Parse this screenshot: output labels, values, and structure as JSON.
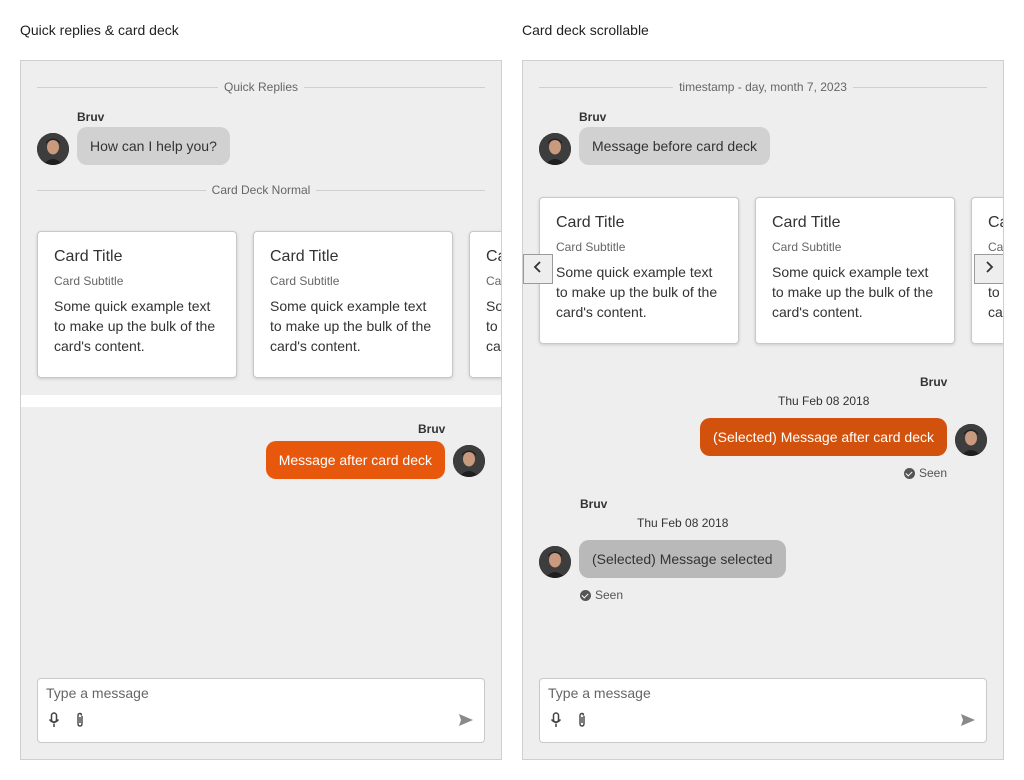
{
  "demos": [
    {
      "title": "Quick replies & card deck",
      "quick_replies_divider": "Quick Replies",
      "author1": "Bruv",
      "msg1": "How can I help you?",
      "card_divider": "Card Deck Normal",
      "cards": [
        {
          "title": "Card Title",
          "subtitle": "Card Subtitle",
          "body": "Some quick example text to make up the bulk of the card's content."
        },
        {
          "title": "Card Title",
          "subtitle": "Card Subtitle",
          "body": "Some quick example text to make up the bulk of the card's content."
        },
        {
          "title": "Card Title",
          "subtitle": "Card Subtitle",
          "body": "Some quick example text to make up the bulk of the card's content."
        }
      ],
      "author2": "Bruv",
      "msg2": "Message after card deck",
      "composer_placeholder": "Type a message"
    },
    {
      "title": "Card deck scrollable",
      "timestamp_divider": "timestamp - day, month 7, 2023",
      "author1": "Bruv",
      "msg1": "Message before card deck",
      "cards": [
        {
          "title": "Card Title",
          "subtitle": "Card Subtitle",
          "body": "Some quick example text to make up the bulk of the card's content."
        },
        {
          "title": "Card Title",
          "subtitle": "Card Subtitle",
          "body": "Some quick example text to make up the bulk of the card's content."
        },
        {
          "title": "Card Title",
          "subtitle": "Card Subtitle",
          "body": "Some quick example text to make up the bulk of the card's content."
        }
      ],
      "author2": "Bruv",
      "time2": "Thu Feb 08 2018",
      "msg2": "(Selected) Message after card deck",
      "seen2": "Seen",
      "author3": "Bruv",
      "time3": "Thu Feb 08 2018",
      "msg3": "(Selected) Message selected",
      "seen3": "Seen",
      "composer_placeholder": "Type a message"
    }
  ],
  "colors": {
    "accent": "#e8580c",
    "accent_selected": "#d2510d",
    "bubble_gray": "#d1d1d1",
    "panel_bg": "#eeeeee"
  },
  "icons": [
    "avatar",
    "microphone-icon",
    "paperclip-icon",
    "send-icon",
    "chevron-left-icon",
    "chevron-right-icon",
    "check-circle-icon"
  ]
}
